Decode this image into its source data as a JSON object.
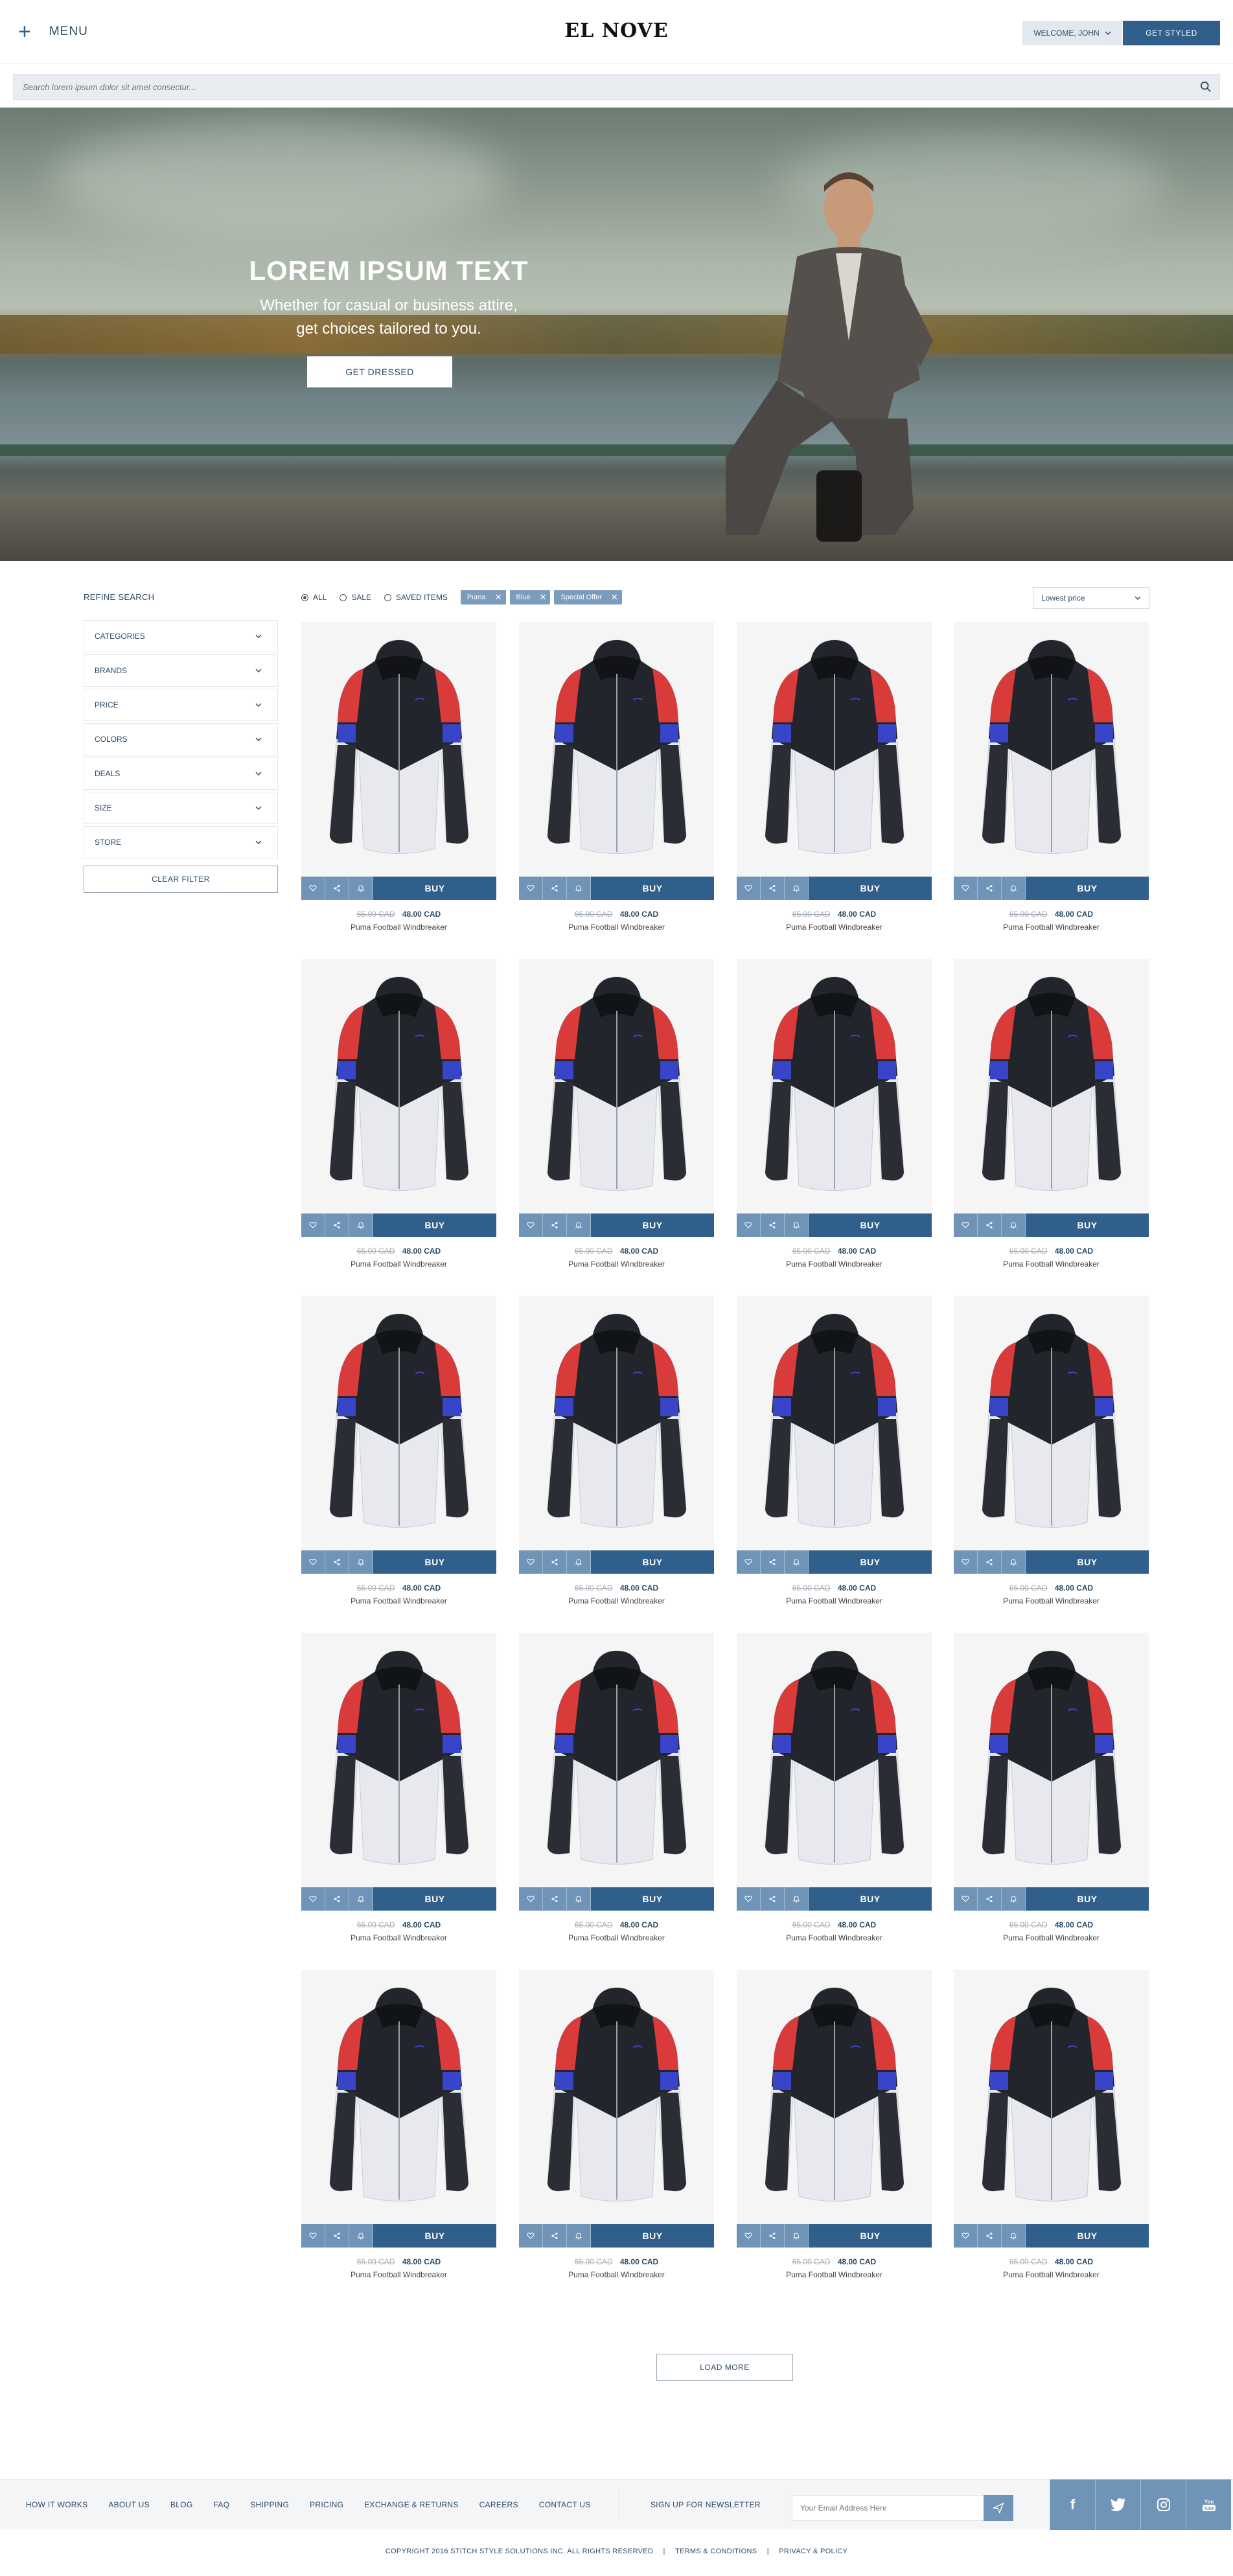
{
  "header": {
    "menu_label": "MENU",
    "logo": "EL NOVE",
    "welcome": "WELCOME, JOHN",
    "get_styled": "GET STYLED"
  },
  "search": {
    "placeholder": "Search lorem ipsum dolor sit amet consectur..."
  },
  "hero": {
    "title": "LOREM IPSUM TEXT",
    "subtitle_line1": "Whether for casual or business attire,",
    "subtitle_line2": "get choices tailored to you.",
    "button": "GET DRESSED"
  },
  "sidebar": {
    "title": "REFINE SEARCH",
    "filters": [
      "CATEGORIES",
      "BRANDS",
      "PRICE",
      "COLORS",
      "DEALS",
      "SIZE",
      "STORE"
    ],
    "clear": "CLEAR FILTER"
  },
  "filter_row": {
    "options": [
      {
        "label": "ALL",
        "selected": true
      },
      {
        "label": "SALE",
        "selected": false
      },
      {
        "label": "SAVED ITEMS",
        "selected": false
      }
    ],
    "tags": [
      "Puma",
      "Blue",
      "Special Offer"
    ],
    "tag_remove": "✕",
    "sort": "Lowest price"
  },
  "product": {
    "old_price": "65.00 CAD",
    "new_price": "48.00 CAD",
    "name": "Puma Football Windbreaker",
    "buy_label": "BUY",
    "count": 20
  },
  "load_more": "LOAD MORE",
  "footer": {
    "links": [
      "HOW IT WORKS",
      "ABOUT US",
      "BLOG",
      "FAQ",
      "SHIPPING",
      "PRICING",
      "EXCHANGE & RETURNS",
      "CAREERS",
      "CONTACT US"
    ],
    "newsletter_label": "SIGN UP FOR NEWSLETTER",
    "newsletter_placeholder": "Your Email Address Here",
    "socials": [
      "facebook-icon",
      "twitter-icon",
      "instagram-icon",
      "youtube-icon"
    ],
    "copyright": "COPYRIGHT 2016 STITCH STYLE SOLUTIONS INC. ALL RIGHTS RESERVED",
    "terms": "TERMS & CONDITIONS",
    "privacy": "PRIVACY & POLICY",
    "separator": "|"
  },
  "colors": {
    "primary": "#2f5f8a",
    "accent_light": "#6f94b8",
    "tag": "#7a9cbd",
    "text_dark": "#2b4b66"
  }
}
